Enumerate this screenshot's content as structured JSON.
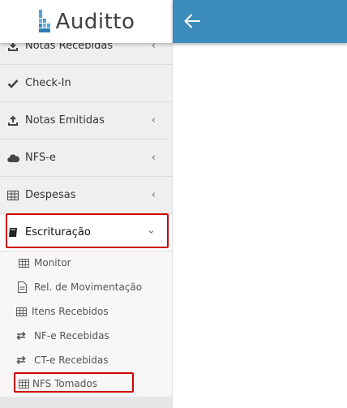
{
  "app": {
    "logo_text": "Auditto"
  },
  "topbar": {
    "back_icon": "arrow-left-icon",
    "color": "#3c8dbc"
  },
  "sidebar": {
    "items": [
      {
        "label": "Notas Recebidas",
        "icon": "download-tray-icon",
        "has_chevron": true
      },
      {
        "label": "Check-In",
        "icon": "check-icon",
        "has_chevron": false
      },
      {
        "label": "Notas Emitidas",
        "icon": "upload-tray-icon",
        "has_chevron": true
      },
      {
        "label": "NFS-e",
        "icon": "cloud-icon",
        "has_chevron": true
      },
      {
        "label": "Despesas",
        "icon": "table-icon",
        "has_chevron": true
      },
      {
        "label": "Escrituração",
        "icon": "book-icon",
        "expanded": true,
        "highlighted": true
      }
    ],
    "chevron_collapsed": "‹",
    "chevron_expanded": "⌄",
    "subitems": [
      {
        "label": "Monitor",
        "icon": "table-icon"
      },
      {
        "label": "Rel. de Movimentação",
        "icon": "document-icon"
      },
      {
        "label": "Itens Recebidos",
        "icon": "table-icon"
      },
      {
        "label": "NF-e Recebidas",
        "icon": "exchange-icon"
      },
      {
        "label": "CT-e Recebidas",
        "icon": "exchange-icon"
      },
      {
        "label": "NFS Tomados",
        "icon": "table-icon",
        "highlighted": true
      }
    ]
  },
  "highlight_color": "#cc0000"
}
